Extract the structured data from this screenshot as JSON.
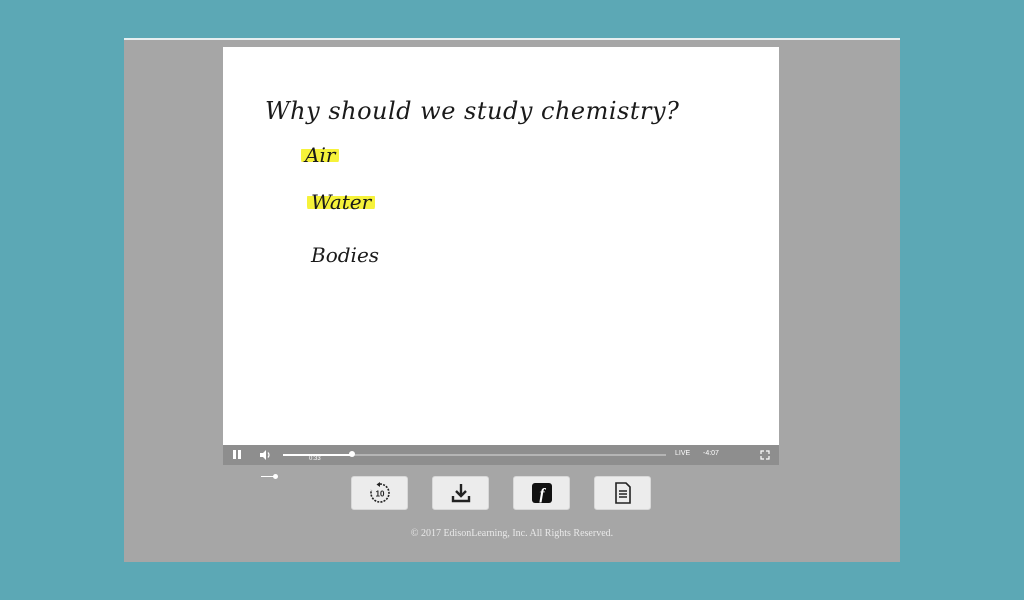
{
  "slide": {
    "title": "Why should we study chemistry?",
    "items": [
      {
        "text": "Air",
        "highlighted": true
      },
      {
        "text": "Water",
        "highlighted": true
      },
      {
        "text": "Bodies",
        "highlighted": false
      }
    ],
    "highlight_color": "#f6f23a"
  },
  "player": {
    "current_time": "0:33",
    "live_label": "LIVE",
    "remaining_time": "-4:07",
    "progress_fraction": 0.18
  },
  "toolbar": {
    "buttons": [
      {
        "icon": "replay-10-icon",
        "label": "10"
      },
      {
        "icon": "download-icon"
      },
      {
        "icon": "flash-icon",
        "label": "f"
      },
      {
        "icon": "document-icon"
      }
    ]
  },
  "footer": {
    "copyright": "© 2017 EdisonLearning, Inc. All Rights Reserved."
  },
  "colors": {
    "background": "#5ca8b5",
    "frame": "#a6a6a6",
    "control_bar": "#8e8e8e"
  }
}
